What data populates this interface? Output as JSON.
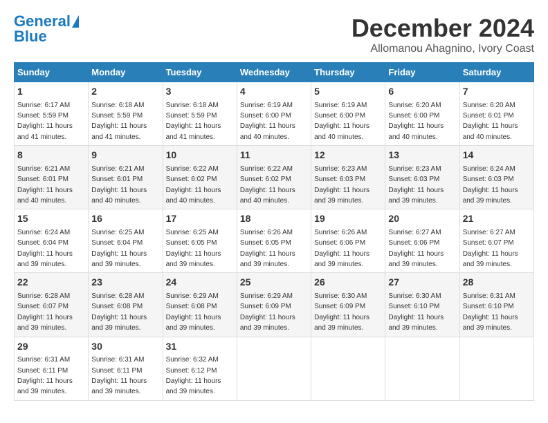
{
  "logo": {
    "line1": "General",
    "line2": "Blue"
  },
  "title": "December 2024",
  "location": "Allomanou Ahagnino, Ivory Coast",
  "days_of_week": [
    "Sunday",
    "Monday",
    "Tuesday",
    "Wednesday",
    "Thursday",
    "Friday",
    "Saturday"
  ],
  "weeks": [
    [
      {
        "day": "1",
        "sunrise": "6:17 AM",
        "sunset": "5:59 PM",
        "daylight": "11 hours and 41 minutes."
      },
      {
        "day": "2",
        "sunrise": "6:18 AM",
        "sunset": "5:59 PM",
        "daylight": "11 hours and 41 minutes."
      },
      {
        "day": "3",
        "sunrise": "6:18 AM",
        "sunset": "5:59 PM",
        "daylight": "11 hours and 41 minutes."
      },
      {
        "day": "4",
        "sunrise": "6:19 AM",
        "sunset": "6:00 PM",
        "daylight": "11 hours and 40 minutes."
      },
      {
        "day": "5",
        "sunrise": "6:19 AM",
        "sunset": "6:00 PM",
        "daylight": "11 hours and 40 minutes."
      },
      {
        "day": "6",
        "sunrise": "6:20 AM",
        "sunset": "6:00 PM",
        "daylight": "11 hours and 40 minutes."
      },
      {
        "day": "7",
        "sunrise": "6:20 AM",
        "sunset": "6:01 PM",
        "daylight": "11 hours and 40 minutes."
      }
    ],
    [
      {
        "day": "8",
        "sunrise": "6:21 AM",
        "sunset": "6:01 PM",
        "daylight": "11 hours and 40 minutes."
      },
      {
        "day": "9",
        "sunrise": "6:21 AM",
        "sunset": "6:01 PM",
        "daylight": "11 hours and 40 minutes."
      },
      {
        "day": "10",
        "sunrise": "6:22 AM",
        "sunset": "6:02 PM",
        "daylight": "11 hours and 40 minutes."
      },
      {
        "day": "11",
        "sunrise": "6:22 AM",
        "sunset": "6:02 PM",
        "daylight": "11 hours and 40 minutes."
      },
      {
        "day": "12",
        "sunrise": "6:23 AM",
        "sunset": "6:03 PM",
        "daylight": "11 hours and 39 minutes."
      },
      {
        "day": "13",
        "sunrise": "6:23 AM",
        "sunset": "6:03 PM",
        "daylight": "11 hours and 39 minutes."
      },
      {
        "day": "14",
        "sunrise": "6:24 AM",
        "sunset": "6:03 PM",
        "daylight": "11 hours and 39 minutes."
      }
    ],
    [
      {
        "day": "15",
        "sunrise": "6:24 AM",
        "sunset": "6:04 PM",
        "daylight": "11 hours and 39 minutes."
      },
      {
        "day": "16",
        "sunrise": "6:25 AM",
        "sunset": "6:04 PM",
        "daylight": "11 hours and 39 minutes."
      },
      {
        "day": "17",
        "sunrise": "6:25 AM",
        "sunset": "6:05 PM",
        "daylight": "11 hours and 39 minutes."
      },
      {
        "day": "18",
        "sunrise": "6:26 AM",
        "sunset": "6:05 PM",
        "daylight": "11 hours and 39 minutes."
      },
      {
        "day": "19",
        "sunrise": "6:26 AM",
        "sunset": "6:06 PM",
        "daylight": "11 hours and 39 minutes."
      },
      {
        "day": "20",
        "sunrise": "6:27 AM",
        "sunset": "6:06 PM",
        "daylight": "11 hours and 39 minutes."
      },
      {
        "day": "21",
        "sunrise": "6:27 AM",
        "sunset": "6:07 PM",
        "daylight": "11 hours and 39 minutes."
      }
    ],
    [
      {
        "day": "22",
        "sunrise": "6:28 AM",
        "sunset": "6:07 PM",
        "daylight": "11 hours and 39 minutes."
      },
      {
        "day": "23",
        "sunrise": "6:28 AM",
        "sunset": "6:08 PM",
        "daylight": "11 hours and 39 minutes."
      },
      {
        "day": "24",
        "sunrise": "6:29 AM",
        "sunset": "6:08 PM",
        "daylight": "11 hours and 39 minutes."
      },
      {
        "day": "25",
        "sunrise": "6:29 AM",
        "sunset": "6:09 PM",
        "daylight": "11 hours and 39 minutes."
      },
      {
        "day": "26",
        "sunrise": "6:30 AM",
        "sunset": "6:09 PM",
        "daylight": "11 hours and 39 minutes."
      },
      {
        "day": "27",
        "sunrise": "6:30 AM",
        "sunset": "6:10 PM",
        "daylight": "11 hours and 39 minutes."
      },
      {
        "day": "28",
        "sunrise": "6:31 AM",
        "sunset": "6:10 PM",
        "daylight": "11 hours and 39 minutes."
      }
    ],
    [
      {
        "day": "29",
        "sunrise": "6:31 AM",
        "sunset": "6:11 PM",
        "daylight": "11 hours and 39 minutes."
      },
      {
        "day": "30",
        "sunrise": "6:31 AM",
        "sunset": "6:11 PM",
        "daylight": "11 hours and 39 minutes."
      },
      {
        "day": "31",
        "sunrise": "6:32 AM",
        "sunset": "6:12 PM",
        "daylight": "11 hours and 39 minutes."
      },
      {
        "day": "",
        "sunrise": "",
        "sunset": "",
        "daylight": ""
      },
      {
        "day": "",
        "sunrise": "",
        "sunset": "",
        "daylight": ""
      },
      {
        "day": "",
        "sunrise": "",
        "sunset": "",
        "daylight": ""
      },
      {
        "day": "",
        "sunrise": "",
        "sunset": "",
        "daylight": ""
      }
    ]
  ]
}
